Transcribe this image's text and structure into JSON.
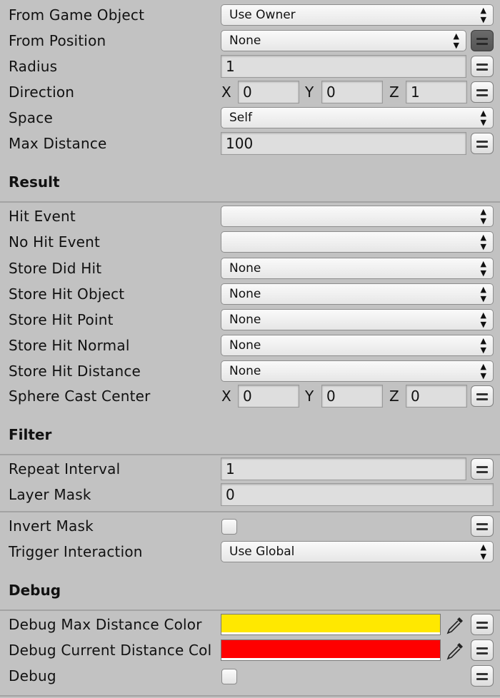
{
  "raycast": {
    "from_game_object": {
      "label": "From Game Object",
      "value": "Use Owner"
    },
    "from_position": {
      "label": "From Position",
      "value": "None"
    },
    "radius": {
      "label": "Radius",
      "value": "1"
    },
    "direction": {
      "label": "Direction",
      "x": "0",
      "y": "0",
      "z": "1"
    },
    "space": {
      "label": "Space",
      "value": "Self"
    },
    "max_distance": {
      "label": "Max Distance",
      "value": "100"
    }
  },
  "result": {
    "title": "Result",
    "hit_event": {
      "label": "Hit Event",
      "value": ""
    },
    "no_hit_event": {
      "label": "No Hit Event",
      "value": ""
    },
    "store_did_hit": {
      "label": "Store Did Hit",
      "value": "None"
    },
    "store_hit_object": {
      "label": "Store Hit Object",
      "value": "None"
    },
    "store_hit_point": {
      "label": "Store Hit Point",
      "value": "None"
    },
    "store_hit_normal": {
      "label": "Store Hit Normal",
      "value": "None"
    },
    "store_hit_distance": {
      "label": "Store Hit Distance",
      "value": "None"
    },
    "sphere_cast_center": {
      "label": "Sphere Cast Center",
      "x": "0",
      "y": "0",
      "z": "0"
    }
  },
  "filter": {
    "title": "Filter",
    "repeat_interval": {
      "label": "Repeat Interval",
      "value": "1"
    },
    "layer_mask": {
      "label": "Layer Mask",
      "value": "0"
    },
    "invert_mask": {
      "label": "Invert Mask",
      "checked": false
    },
    "trigger_interaction": {
      "label": "Trigger Interaction",
      "value": "Use Global"
    }
  },
  "debug": {
    "title": "Debug",
    "max_distance_color": {
      "label": "Debug Max Distance Color",
      "color": "#ffe800"
    },
    "current_distance_color": {
      "label": "Debug Current Distance Color",
      "color": "#ff0000"
    },
    "debug": {
      "label": "Debug",
      "checked": false
    }
  },
  "axis_labels": {
    "x": "X",
    "y": "Y",
    "z": "Z"
  },
  "icons": {
    "variable_toggle": "equals-icon",
    "dropdown_arrows": "up-down-arrows-icon",
    "color_picker": "eyedropper-icon"
  }
}
